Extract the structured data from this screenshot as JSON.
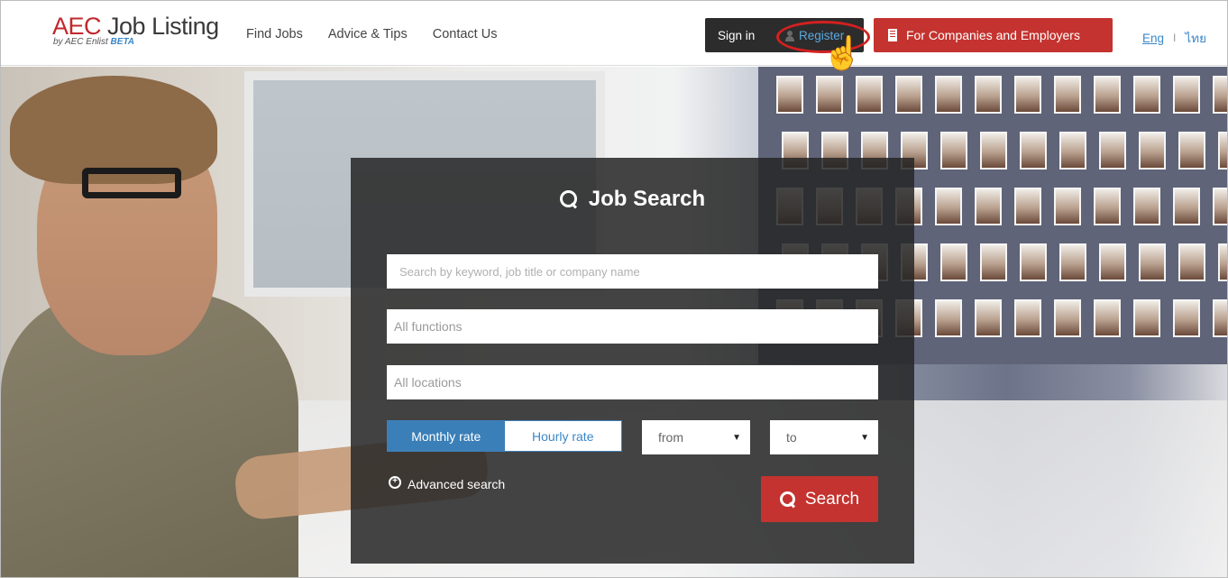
{
  "header": {
    "logo": {
      "main_prefix": "AEC",
      "main_suffix": " Job Listing",
      "sub": "by AEC Enlist",
      "beta": "BETA"
    },
    "nav": [
      {
        "label": "Find Jobs"
      },
      {
        "label": "Advice & Tips"
      },
      {
        "label": "Contact Us"
      }
    ],
    "signin_label": "Sign in",
    "register_label": "Register",
    "company_button_label": "For Companies and Employers",
    "lang": {
      "eng": "Eng",
      "separator": "I",
      "thai": "ไทย"
    }
  },
  "search": {
    "title": "Job Search",
    "keyword_placeholder": "Search by keyword, job title or company name",
    "functions_placeholder": "All functions",
    "locations_placeholder": "All locations",
    "rate_options": [
      {
        "label": "Monthly rate",
        "active": true
      },
      {
        "label": "Hourly rate",
        "active": false
      }
    ],
    "from_label": "from",
    "to_label": "to",
    "advanced_label": "Advanced search",
    "search_button_label": "Search"
  },
  "colors": {
    "brand_red": "#c4332f",
    "accent_blue": "#3a87c8",
    "panel_bg": "#262626"
  },
  "icons": [
    "user-icon",
    "building-icon",
    "search-icon",
    "zoom-in-icon",
    "chevron-down-icon",
    "hand-pointer-icon"
  ]
}
